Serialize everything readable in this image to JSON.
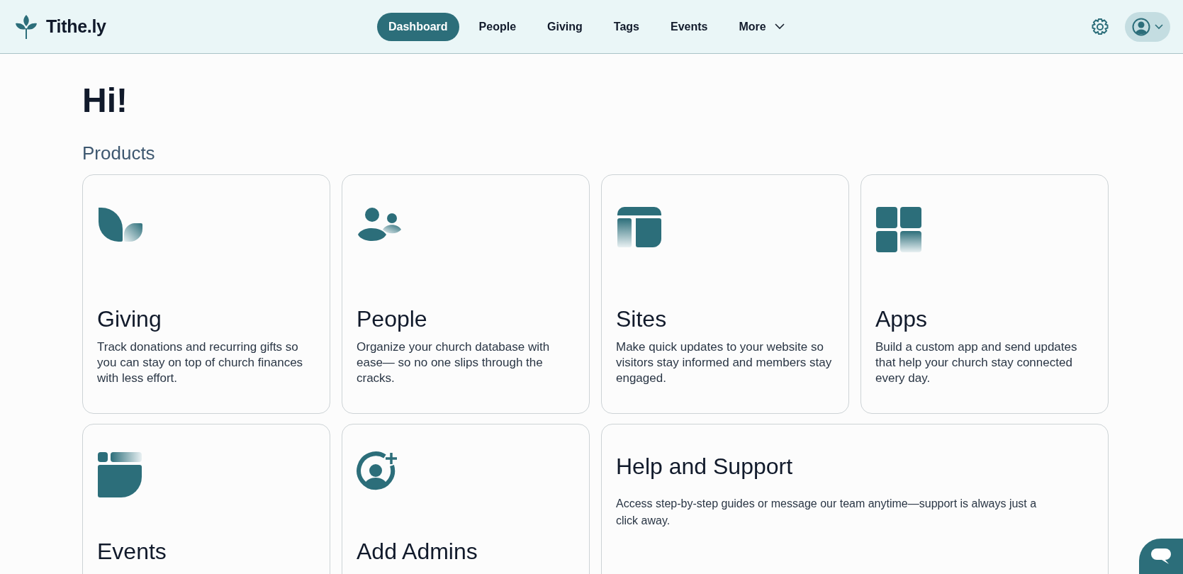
{
  "header": {
    "logo": "Tithe.ly",
    "nav": [
      {
        "label": "Dashboard",
        "selected": true,
        "kind": "link"
      },
      {
        "label": "People",
        "selected": false,
        "kind": "link"
      },
      {
        "label": "Giving",
        "selected": false,
        "kind": "link"
      },
      {
        "label": "Tags",
        "selected": false,
        "kind": "link"
      },
      {
        "label": "Events",
        "selected": false,
        "kind": "link"
      },
      {
        "label": "More",
        "selected": false,
        "kind": "menu"
      }
    ]
  },
  "greeting": "Hi!",
  "section_title": "Products",
  "products": [
    {
      "kind": "giving",
      "title": "Giving",
      "description": "Track donations and recurring gifts so you can stay on top of church finances with less effort."
    },
    {
      "kind": "people",
      "title": "People",
      "description": "Organize your church database with ease— so no one slips through the cracks."
    },
    {
      "kind": "sites",
      "title": "Sites",
      "description": "Make quick updates to your website so visitors stay informed and members stay engaged."
    },
    {
      "kind": "apps",
      "title": "Apps",
      "description": "Build a custom app and send updates that help your church stay connected every day."
    },
    {
      "kind": "events",
      "title": "Events"
    },
    {
      "kind": "admins",
      "title": "Add Admins"
    },
    {
      "kind": "help",
      "title": "Help and Support",
      "description": "Access step-by-step guides or message our team anytime—support is always just a click away."
    }
  ]
}
